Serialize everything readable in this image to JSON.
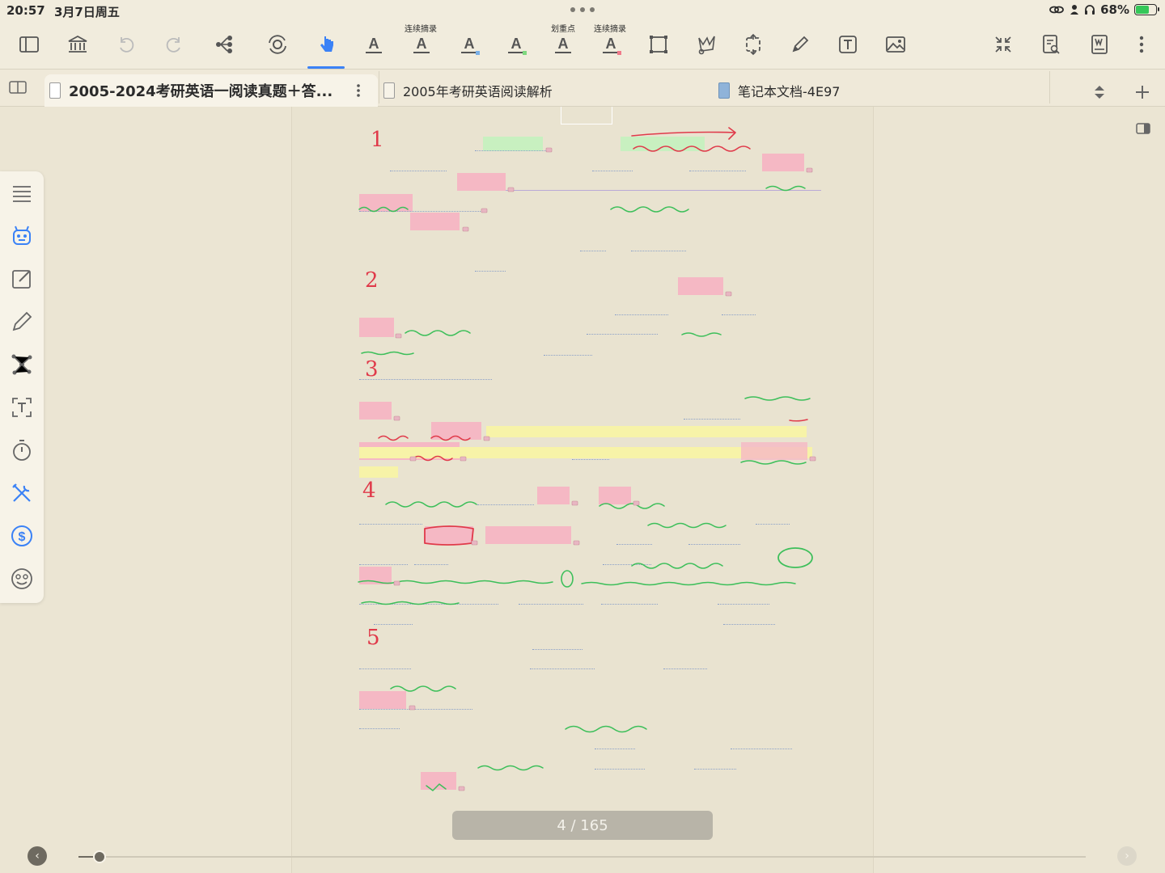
{
  "status_bar": {
    "time": "20:57",
    "date": "3月7日周五",
    "battery_percent": "68%",
    "battery_level": 0.68
  },
  "toolbar": {
    "captions": {
      "continuous_excerpt_1": "连续摘录",
      "highlight_point": "划重点",
      "continuous_excerpt_2": "连续摘录"
    },
    "active_tool": "gesture-hand-icon",
    "accent": "#3b82f6"
  },
  "tabs": [
    {
      "title": "2005-2024考研英语一阅读真题＋答...",
      "active": true
    },
    {
      "title": "2005年考研英语阅读解析",
      "active": false
    },
    {
      "title": "笔记本文档-4E97",
      "active": false
    }
  ],
  "page": {
    "section_numbers": [
      "1",
      "2",
      "3",
      "4",
      "5"
    ],
    "indicator": "4 / 165",
    "current_page": 4,
    "total_pages": 165
  },
  "colors": {
    "highlight_pink": "#f5b8c4",
    "highlight_green": "#c8f0c0",
    "highlight_yellow": "#f7f3a8",
    "ink_red": "#e03a4a",
    "ink_green": "#3dbf5a"
  }
}
